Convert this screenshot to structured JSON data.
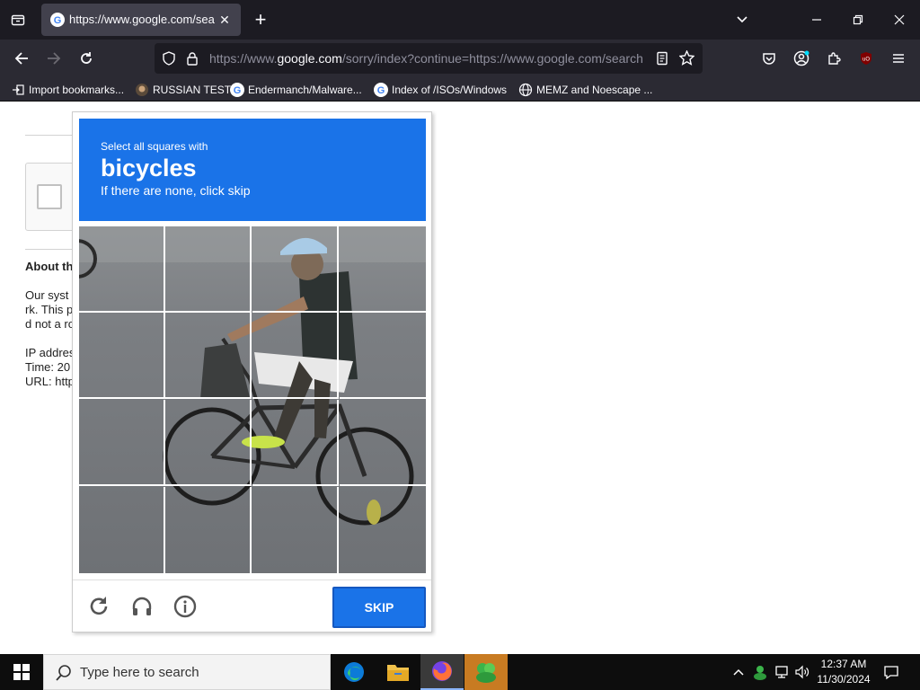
{
  "browser": {
    "tab_title": "https://www.google.com/search",
    "url": {
      "scheme": "https://www.",
      "host": "google.com",
      "rest": "/sorry/index?continue=https://www.google.com/search"
    },
    "bookmarks": [
      {
        "label": "Import bookmarks...",
        "icon": "import-icon"
      },
      {
        "label": "RUSSIAN TEST",
        "icon": "russian-test-icon"
      },
      {
        "label": "Endermanch/Malware...",
        "icon": "google-icon"
      },
      {
        "label": "Index of /ISOs/Windows",
        "icon": "google-icon"
      },
      {
        "label": "MEMZ and Noescape ...",
        "icon": "globe-icon"
      }
    ]
  },
  "page": {
    "about_title": "About th",
    "about_lines": [
      "Our syst",
      "rk. This p",
      "d not a ro",
      "IP addres",
      "Time: 20",
      "URL: http"
    ]
  },
  "challenge": {
    "instruction_small": "Select all squares with",
    "target": "bicycles",
    "instruction_hint": "If there are none, click skip",
    "skip_label": "SKIP"
  },
  "taskbar": {
    "search_placeholder": "Type here to search",
    "time": "12:37 AM",
    "date": "11/30/2024"
  },
  "colors": {
    "accent": "#1a73e8",
    "chrome_dark": "#1c1b22",
    "toolbar": "#2b2a33"
  }
}
